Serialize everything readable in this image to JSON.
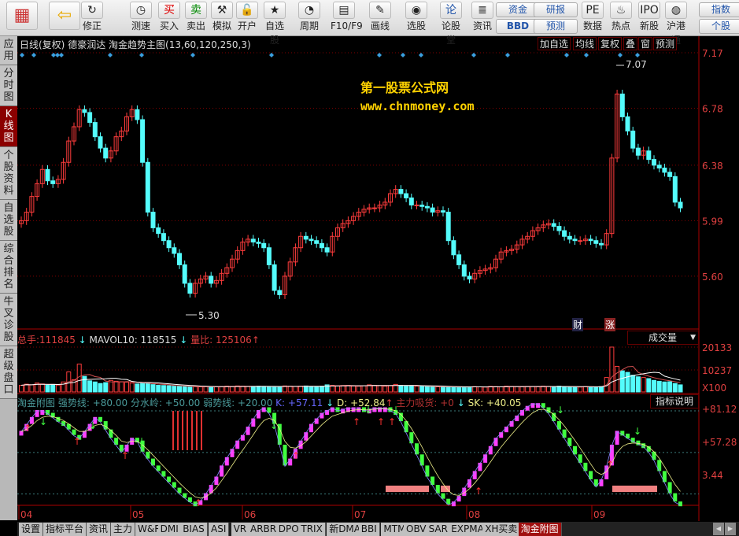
{
  "toolbar": {
    "items": [
      {
        "label": "",
        "icon": "grid-icon"
      },
      {
        "label": "",
        "icon": "back-arrow-icon"
      },
      {
        "label": "修正",
        "icon": "refresh-icon"
      },
      {
        "label": "测速",
        "icon": "clock-icon"
      },
      {
        "label": "买入",
        "icon": "buy-icon",
        "glyph": "买"
      },
      {
        "label": "卖出",
        "icon": "sell-icon",
        "glyph": "卖"
      },
      {
        "label": "模拟",
        "icon": "hammer-icon"
      },
      {
        "label": "开户",
        "icon": "lock-icon"
      },
      {
        "label": "自选股",
        "icon": "star-folder-icon"
      },
      {
        "label": "周期",
        "icon": "clock-cycle-icon"
      },
      {
        "label": "F10/F9",
        "icon": "f10-icon"
      },
      {
        "label": "画线",
        "icon": "pencil-icon"
      },
      {
        "label": "选股",
        "icon": "select-stock-icon"
      },
      {
        "label": "论股堂",
        "icon": "forum-icon",
        "glyph": "论"
      },
      {
        "label": "资讯",
        "icon": "news-icon"
      },
      {
        "label": "数据",
        "icon": "pe-icon",
        "glyph": "PE"
      },
      {
        "label": "热点",
        "icon": "hot-icon"
      },
      {
        "label": "新股",
        "icon": "ipo-icon",
        "glyph": "IPO"
      },
      {
        "label": "沪港通",
        "icon": "sse-hke-icon"
      }
    ],
    "small_buttons": [
      "资金",
      "BBD",
      "研报",
      "预测",
      "指数",
      "个股"
    ]
  },
  "sidebar": [
    "应用",
    "分时图",
    "K线图",
    "个股资料",
    "自选股",
    "综合排名",
    "牛叉诊股",
    "超级盘口"
  ],
  "sidebar_active": 2,
  "main": {
    "title": "日线(复权)",
    "stock": "德豪润达",
    "indicator": "淘金趋势主图(13,60,120,250,3)",
    "buttons": [
      "加自选",
      "均线",
      "复权",
      "叠",
      "窗",
      "预测"
    ],
    "watermark1": "第一股票公式网",
    "watermark2": "www.chnmoney.com",
    "max_label": "7.07",
    "min_label": "5.30",
    "badge_cai": "财",
    "badge_zhang": "涨"
  },
  "volume": {
    "total_label": "总手:",
    "total": "111845",
    "mavol_label": "MAVOL10:",
    "mavol": "118515",
    "ratio_label": "量比:",
    "ratio": "125106",
    "dropdown": "成交量"
  },
  "sub": {
    "name": "淘金附图",
    "strong": "强势线: +80.00",
    "mid": "分水岭: +50.00",
    "weak": "弱势线: +20.00",
    "k": "K: +57.11",
    "d": "D: +52.84",
    "main_force": "主力吸货: +0",
    "sk": "SK: +40.05",
    "help": "指标说明"
  },
  "tabs": [
    "设置",
    "指标平台",
    "资讯",
    "主力",
    "W&R",
    "DMI",
    "BIAS",
    "ASI",
    "VR",
    "ARBR",
    "DPO",
    "TRIX",
    "新DMA",
    "BBI",
    "MTM",
    "OBV",
    "SAR",
    "EXPMA",
    "XH买卖",
    "淘金附图"
  ],
  "tabs_active": 19,
  "colors": {
    "up": "#ff3c3c",
    "down": "#54fcfc",
    "grid": "#800000",
    "k_up": "#ff40ff",
    "k_down": "#40ff40"
  },
  "chart_data": [
    {
      "type": "candlestick",
      "yaxis_ticks": [
        "7.17",
        "6.78",
        "6.38",
        "5.99",
        "5.60"
      ],
      "xaxis_ticks": [
        "04",
        "05",
        "06",
        "07",
        "08",
        "09"
      ],
      "close": [
        5.99,
        6.05,
        6.16,
        6.25,
        6.35,
        6.27,
        6.25,
        6.28,
        6.4,
        6.55,
        6.65,
        6.77,
        6.75,
        6.68,
        6.58,
        6.5,
        6.43,
        6.48,
        6.58,
        6.62,
        6.72,
        6.77,
        6.7,
        6.4,
        6.05,
        5.94,
        5.9,
        5.85,
        5.8,
        5.76,
        5.68,
        5.55,
        5.48,
        5.55,
        5.58,
        5.6,
        5.55,
        5.57,
        5.62,
        5.66,
        5.72,
        5.78,
        5.84,
        5.86,
        5.84,
        5.83,
        5.8,
        5.68,
        5.5,
        5.47,
        5.6,
        5.7,
        5.8,
        5.88,
        5.86,
        5.85,
        5.83,
        5.8,
        5.77,
        5.88,
        5.94,
        5.97,
        5.99,
        6.02,
        6.05,
        6.07,
        6.08,
        6.08,
        6.1,
        6.12,
        6.18,
        6.21,
        6.18,
        6.15,
        6.1,
        6.1,
        6.09,
        6.08,
        6.05,
        6.06,
        6.05,
        5.85,
        5.75,
        5.68,
        5.6,
        5.58,
        5.62,
        5.64,
        5.65,
        5.66,
        5.72,
        5.77,
        5.78,
        5.79,
        5.82,
        5.86,
        5.88,
        5.92,
        5.94,
        5.96,
        5.97,
        5.95,
        5.92,
        5.88,
        5.86,
        5.85,
        5.85,
        5.86,
        5.85,
        5.83,
        5.82,
        5.9,
        6.43,
        6.88,
        6.72,
        6.62,
        6.5,
        6.45,
        6.48,
        6.42,
        6.38,
        6.36,
        6.33,
        6.3,
        6.12,
        6.08
      ]
    },
    {
      "type": "bar",
      "name": "成交量",
      "yaxis_ticks": [
        "20133",
        "10237",
        "X100"
      ],
      "values": [
        3000,
        3500,
        3200,
        4000,
        3600,
        3000,
        3400,
        3100,
        4500,
        9000,
        5500,
        12500,
        7000,
        5000,
        4500,
        3800,
        4200,
        5200,
        4800,
        4600,
        4400,
        4000,
        3600,
        3800,
        4100,
        3300,
        3000,
        2900,
        2800,
        2600,
        2500,
        2400,
        2300,
        2400,
        2300,
        2400,
        2200,
        2300,
        2400,
        2600,
        2500,
        2700,
        2600,
        2500,
        2400,
        2600,
        2500,
        2300,
        2400,
        2300,
        2700,
        2600,
        2500,
        2600,
        2700,
        2500,
        2400,
        2600,
        3200,
        3000,
        2800,
        2900,
        3000,
        2700,
        2600,
        2800,
        3200,
        3000,
        2900,
        2600,
        2800,
        3400,
        3000,
        2800,
        2700,
        2600,
        2500,
        2400,
        2400,
        2300,
        2300,
        2200,
        2300,
        2200,
        2300,
        2200,
        2400,
        2300,
        2200,
        2500,
        2400,
        2300,
        2600,
        2500,
        2400,
        2300,
        2500,
        2400,
        2300,
        2600,
        2500,
        2400,
        2600,
        2300,
        2200,
        2300,
        2200,
        2400,
        2300,
        2200,
        2400,
        6500,
        20133,
        11500,
        9500,
        8800,
        7500,
        6800,
        6500,
        6000,
        5200,
        4800,
        4500,
        4600,
        3800,
        3200
      ]
    },
    {
      "type": "line",
      "name": "淘金附图",
      "yaxis_ticks": [
        "+81.12",
        "+57.28",
        "3.44"
      ],
      "levels": [
        80,
        50,
        20
      ],
      "k": [
        65,
        70,
        75,
        80,
        80,
        78,
        75,
        72,
        70,
        66,
        62,
        60,
        65,
        70,
        75,
        72,
        66,
        60,
        55,
        50,
        55,
        60,
        58,
        50,
        45,
        40,
        36,
        32,
        28,
        24,
        20,
        17,
        14,
        12,
        15,
        20,
        26,
        32,
        40,
        46,
        52,
        58,
        62,
        68,
        74,
        80,
        82,
        78,
        70,
        55,
        40,
        45,
        52,
        58,
        64,
        70,
        74,
        78,
        80,
        82,
        80,
        81,
        82,
        82,
        82,
        80,
        81,
        82,
        82,
        82,
        80,
        78,
        72,
        64,
        56,
        48,
        40,
        32,
        26,
        20,
        16,
        12,
        14,
        18,
        24,
        30,
        36,
        42,
        48,
        54,
        60,
        64,
        68,
        72,
        76,
        80,
        83,
        85,
        85,
        82,
        78,
        72,
        66,
        60,
        54,
        48,
        42,
        36,
        30,
        25,
        30,
        40,
        55,
        65,
        63,
        60,
        58,
        56,
        54,
        50,
        44,
        36,
        28,
        20,
        14,
        12
      ]
    }
  ]
}
